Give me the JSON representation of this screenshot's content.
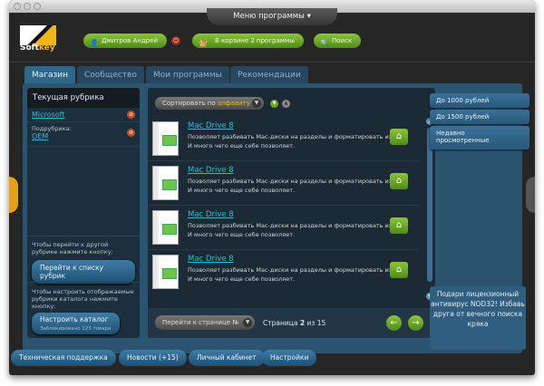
{
  "window": {
    "menu_label": "Меню программы ▾"
  },
  "logo": {
    "text_a": "Soft",
    "text_b": "key"
  },
  "header": {
    "user": "Дмитров Андрей",
    "cart": "В корзине 2 программы",
    "search": "Поиск"
  },
  "tabs": [
    {
      "label": "Магазин",
      "active": true
    },
    {
      "label": "Сообщество"
    },
    {
      "label": "Мои программы"
    },
    {
      "label": "Рекомендации"
    }
  ],
  "left": {
    "title": "Текущая рубрика",
    "category": "Microsoft",
    "sub_label": "Подрубрика:",
    "sub_value": "OEM",
    "hint1": "Чтобы перейти к другой рубрике нажмите кнопку:",
    "btn1": "Перейти к списку рубрик",
    "hint2": "Чтобы настроить отображаемые рубрики каталога нажмите кнопку:",
    "btn2": "Настроить каталог",
    "btn2_sub": "Заблокировано 123 товара"
  },
  "sort": {
    "prefix": "Сортировать по ",
    "value": "алфавиту"
  },
  "products": [
    {
      "title": "Mac Drive 8",
      "desc": "Позволяет разбивать Mac-диски на разделы и форматировать их. И много чего еще себе позволяет."
    },
    {
      "title": "Mac Drive 8",
      "desc": "Позволяет разбивать Mac-диски на разделы и форматировать их. И много чего еще себе позволяет."
    },
    {
      "title": "Mac Drive 8",
      "desc": "Позволяет разбивать Mac-диски на разделы и форматировать их. И много чего еще себе позволяет."
    },
    {
      "title": "Mac Drive 8",
      "desc": "Позволяет разбивать Mac-диски на разделы и форматировать их. И много чего еще себе позволяет."
    }
  ],
  "pager": {
    "goto": "Перейти к странице №",
    "prefix": "Страница ",
    "current": "2",
    "sep": " из ",
    "total": "15"
  },
  "right": {
    "filters": [
      "До 1000 рублей",
      "До 1500 рублей",
      "Недавно просмотренные"
    ],
    "promo": "Подари лицензионный антивирус NOD32! Избавь друга от вечного поиска кряка"
  },
  "footer": [
    "Техническая поддержка",
    "Новости (+15)",
    "Личный кабинет",
    "Настройки"
  ]
}
